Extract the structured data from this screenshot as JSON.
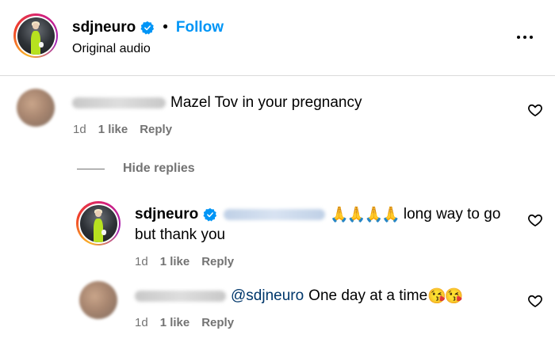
{
  "header": {
    "username": "sdjneuro",
    "separator": "•",
    "follow_label": "Follow",
    "subtitle": "Original audio",
    "verified_icon": "verified-badge-icon",
    "more_icon": "more-options-icon"
  },
  "comments": [
    {
      "text": "Mazel Tov in your pregnancy",
      "time": "1d",
      "likes": "1 like",
      "reply_label": "Reply"
    }
  ],
  "hide_replies_label": "Hide replies",
  "replies": [
    {
      "username": "sdjneuro",
      "prayer_emojis": "🙏🙏🙏🙏",
      "text_line1": "long way to go",
      "text_line2": "but thank you",
      "time": "1d",
      "likes": "1 like",
      "reply_label": "Reply"
    },
    {
      "mention": "@sdjneuro",
      "text": "One day at a time",
      "emojis": "😘😘",
      "time": "1d",
      "likes": "1 like",
      "reply_label": "Reply"
    }
  ],
  "colors": {
    "link_blue": "#0095f6",
    "mention_blue": "#00376b",
    "meta_gray": "#737373",
    "verified_blue": "#0095f6"
  }
}
